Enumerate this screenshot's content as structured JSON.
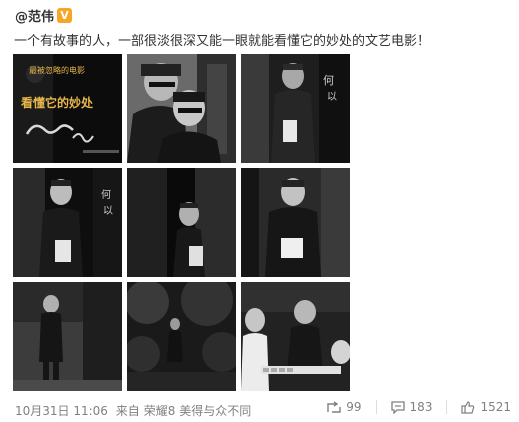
{
  "post": {
    "author": "@范伟",
    "text": "一个有故事的人，一部很淡很深又能一眼就能看懂它的妙处的文艺电影！",
    "photos": [
      {
        "name": "poster-photo",
        "overlay_lines": [
          "最被忽略的电影",
          "看懂它的妙处"
        ]
      },
      {
        "name": "photo-two-men"
      },
      {
        "name": "photo-man-doorway"
      },
      {
        "name": "photo-man-behind-door"
      },
      {
        "name": "photo-man-peeking"
      },
      {
        "name": "photo-man-robe"
      },
      {
        "name": "photo-man-walking"
      },
      {
        "name": "photo-courtyard"
      },
      {
        "name": "photo-mahjong"
      }
    ]
  },
  "footer": {
    "date": "10月31日 11:06",
    "source_prefix": "来自",
    "source": "荣耀8 美得与众不同",
    "repost_count": "99",
    "comment_count": "183",
    "like_count": "1521"
  },
  "colors": {
    "vip_badge": "#f6a623",
    "poster_text": "#e8b74a",
    "meta_text": "#808080"
  },
  "icons": {
    "vip": "vip-badge-icon",
    "repost": "share-icon",
    "comment": "comment-icon",
    "like": "thumbs-up-icon"
  }
}
